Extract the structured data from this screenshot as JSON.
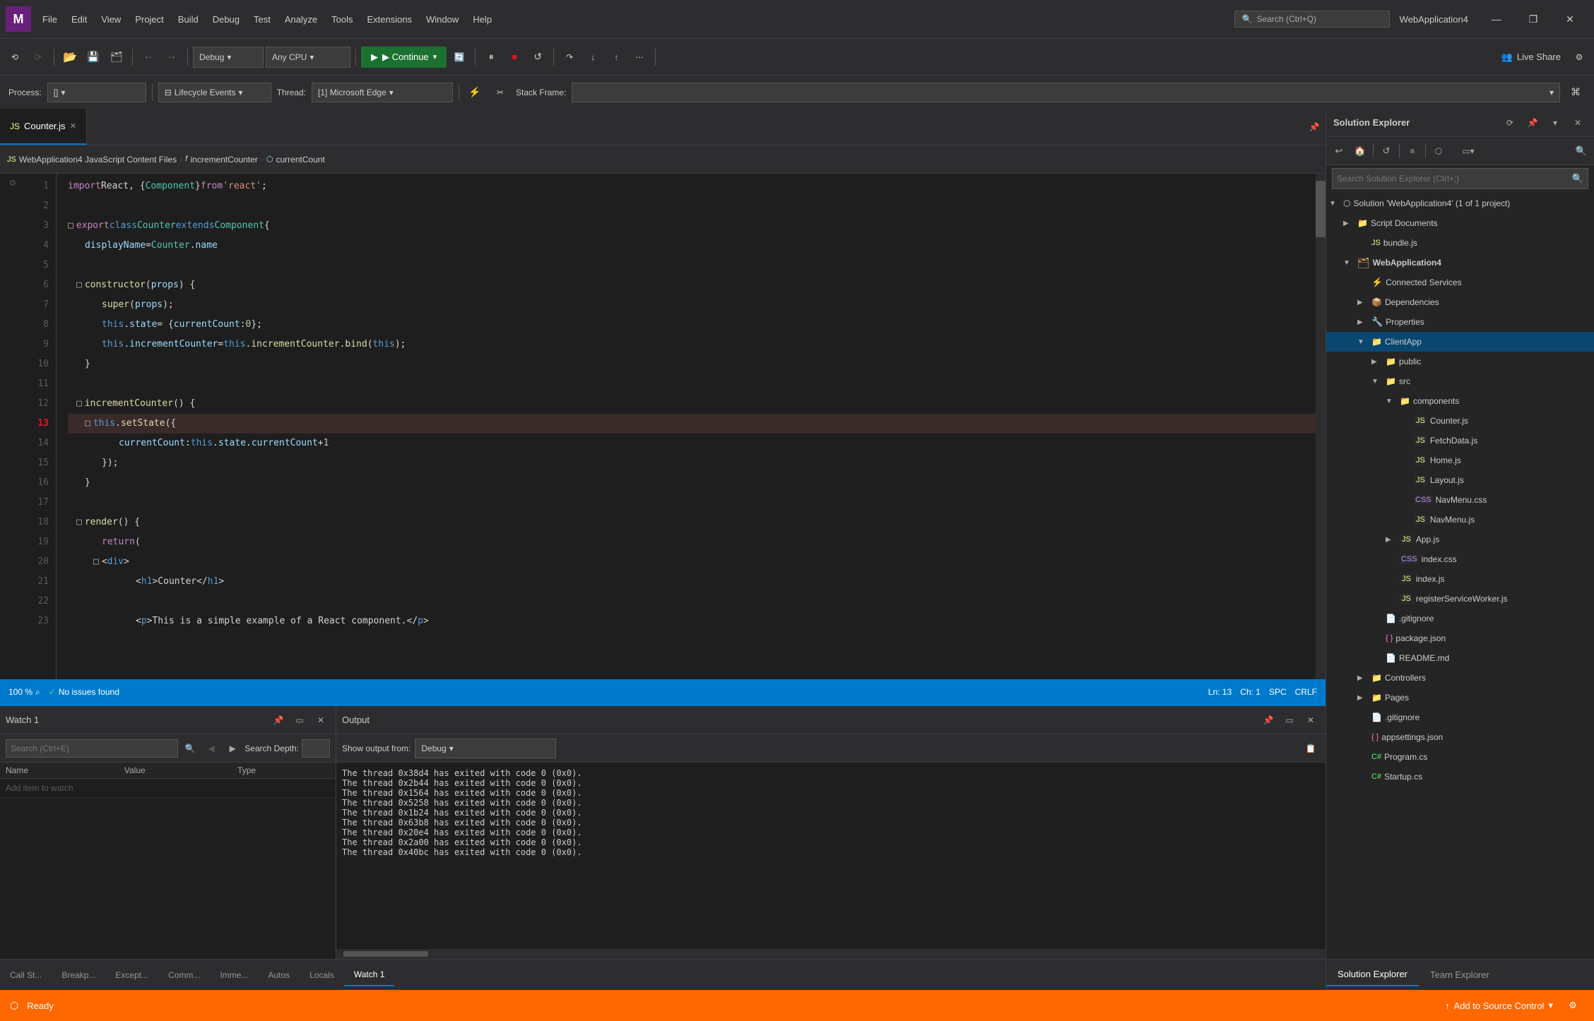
{
  "titlebar": {
    "app_name": "WebApplication4",
    "menu_items": [
      "File",
      "Edit",
      "View",
      "Project",
      "Build",
      "Debug",
      "Test",
      "Analyze",
      "Tools",
      "Extensions",
      "Window",
      "Help"
    ],
    "search_placeholder": "Search (Ctrl+Q)",
    "minimize": "—",
    "maximize": "❐",
    "close": "✕"
  },
  "toolbar": {
    "debug_config": "Debug",
    "platform": "Any CPU",
    "continue_label": "▶ Continue",
    "live_share_label": "Live Share"
  },
  "debug_bar": {
    "process_label": "Process:",
    "process_value": "[]",
    "lifecycle_label": "Lifecycle Events",
    "thread_label": "Thread:",
    "thread_value": "[1] Microsoft Edge",
    "stack_label": "Stack Frame:"
  },
  "editor": {
    "tab_name": "Counter.js",
    "breadcrumb1": "WebApplication4 JavaScript Content Files",
    "breadcrumb2": "incrementCounter",
    "breadcrumb3": "currentCount",
    "lines": [
      {
        "num": 1,
        "code": "    import React, { Component } from 'react';"
      },
      {
        "num": 2,
        "code": ""
      },
      {
        "num": 3,
        "code": "□ export class Counter extends Component {"
      },
      {
        "num": 4,
        "code": "    displayName = Counter.name"
      },
      {
        "num": 5,
        "code": ""
      },
      {
        "num": 6,
        "code": "□  constructor(props) {"
      },
      {
        "num": 7,
        "code": "     super(props);"
      },
      {
        "num": 8,
        "code": "     this.state = { currentCount: 0 };"
      },
      {
        "num": 9,
        "code": "     this.incrementCounter = this.incrementCounter.bind(this);"
      },
      {
        "num": 10,
        "code": "   }"
      },
      {
        "num": 11,
        "code": ""
      },
      {
        "num": 12,
        "code": "□  incrementCounter() {"
      },
      {
        "num": 13,
        "code": "□    this.setState({"
      },
      {
        "num": 14,
        "code": "       currentCount: this.state.currentCount + 1"
      },
      {
        "num": 15,
        "code": "     });"
      },
      {
        "num": 16,
        "code": "   }"
      },
      {
        "num": 17,
        "code": ""
      },
      {
        "num": 18,
        "code": "□  render() {"
      },
      {
        "num": 19,
        "code": "     return ("
      },
      {
        "num": 20,
        "code": "□      <div>"
      },
      {
        "num": 21,
        "code": "         <h1>Counter</h1>"
      },
      {
        "num": 22,
        "code": ""
      },
      {
        "num": 23,
        "code": "         <p>This is a simple example of a React component.</p>"
      }
    ],
    "status_zoom": "100 %",
    "status_issues": "No issues found",
    "status_ln": "Ln: 13",
    "status_col": "Ch: 1",
    "status_spc": "SPC",
    "status_crlf": "CRLF"
  },
  "watch_panel": {
    "title": "Watch 1",
    "search_placeholder": "Search (Ctrl+E)",
    "depth_label": "Search Depth:",
    "col_name": "Name",
    "col_value": "Value",
    "col_type": "Type",
    "add_item": "Add item to watch"
  },
  "output_panel": {
    "title": "Output",
    "show_from_label": "Show output from:",
    "source": "Debug",
    "lines": [
      "The thread 0x38d4 has exited with code 0 (0x0).",
      "The thread 0x2b44 has exited with code 0 (0x0).",
      "The thread 0x1564 has exited with code 0 (0x0).",
      "The thread 0x5258 has exited with code 0 (0x0).",
      "The thread 0x1b24 has exited with code 0 (0x0).",
      "The thread 0x63b8 has exited with code 0 (0x0).",
      "The thread 0x20e4 has exited with code 0 (0x0).",
      "The thread 0x2a00 has exited with code 0 (0x0).",
      "The thread 0x40bc has exited with code 0 (0x0)."
    ]
  },
  "bottom_tabs": [
    "Call St...",
    "Breakp...",
    "Except...",
    "Comm...",
    "Imme...",
    "Autos",
    "Locals",
    "Watch 1"
  ],
  "solution_explorer": {
    "title": "Solution Explorer",
    "search_placeholder": "Search Solution Explorer (Ctrl+;)",
    "tree": [
      {
        "label": "Solution 'WebApplication4' (1 of 1 project)",
        "indent": 0,
        "icon": "solution",
        "expand": "▼"
      },
      {
        "label": "Script Documents",
        "indent": 1,
        "icon": "folder",
        "expand": "▶"
      },
      {
        "label": "bundle.js",
        "indent": 2,
        "icon": "js",
        "expand": ""
      },
      {
        "label": "WebApplication4",
        "indent": 1,
        "icon": "project",
        "expand": "▼"
      },
      {
        "label": "Connected Services",
        "indent": 2,
        "icon": "connected",
        "expand": ""
      },
      {
        "label": "Dependencies",
        "indent": 2,
        "icon": "deps",
        "expand": "▶"
      },
      {
        "label": "Properties",
        "indent": 2,
        "icon": "props",
        "expand": "▶"
      },
      {
        "label": "ClientApp",
        "indent": 2,
        "icon": "folder",
        "expand": "▼"
      },
      {
        "label": "public",
        "indent": 3,
        "icon": "folder",
        "expand": "▶"
      },
      {
        "label": "src",
        "indent": 3,
        "icon": "folder",
        "expand": "▼"
      },
      {
        "label": "components",
        "indent": 4,
        "icon": "folder",
        "expand": "▼"
      },
      {
        "label": "Counter.js",
        "indent": 5,
        "icon": "js",
        "expand": ""
      },
      {
        "label": "FetchData.js",
        "indent": 5,
        "icon": "js",
        "expand": ""
      },
      {
        "label": "Home.js",
        "indent": 5,
        "icon": "js",
        "expand": ""
      },
      {
        "label": "Layout.js",
        "indent": 5,
        "icon": "js",
        "expand": ""
      },
      {
        "label": "NavMenu.css",
        "indent": 5,
        "icon": "css",
        "expand": ""
      },
      {
        "label": "NavMenu.js",
        "indent": 5,
        "icon": "js",
        "expand": ""
      },
      {
        "label": "App.js",
        "indent": 4,
        "icon": "js",
        "expand": "▶"
      },
      {
        "label": "index.css",
        "indent": 4,
        "icon": "css",
        "expand": ""
      },
      {
        "label": "index.js",
        "indent": 4,
        "icon": "js",
        "expand": ""
      },
      {
        "label": "registerServiceWorker.js",
        "indent": 4,
        "icon": "js",
        "expand": ""
      },
      {
        "label": ".gitignore",
        "indent": 3,
        "icon": "file",
        "expand": ""
      },
      {
        "label": "package.json",
        "indent": 3,
        "icon": "json",
        "expand": ""
      },
      {
        "label": "README.md",
        "indent": 3,
        "icon": "file",
        "expand": ""
      },
      {
        "label": "Controllers",
        "indent": 2,
        "icon": "folder",
        "expand": "▶"
      },
      {
        "label": "Pages",
        "indent": 2,
        "icon": "folder",
        "expand": "▶"
      },
      {
        "label": ".gitignore",
        "indent": 2,
        "icon": "file",
        "expand": ""
      },
      {
        "label": "appsettings.json",
        "indent": 2,
        "icon": "json",
        "expand": ""
      },
      {
        "label": "Program.cs",
        "indent": 2,
        "icon": "cs",
        "expand": ""
      },
      {
        "label": "Startup.cs",
        "indent": 2,
        "icon": "cs",
        "expand": ""
      }
    ],
    "bottom_tabs": [
      "Solution Explorer",
      "Team Explorer"
    ]
  },
  "statusbar": {
    "ready": "Ready",
    "add_source": "Add to Source Control"
  }
}
